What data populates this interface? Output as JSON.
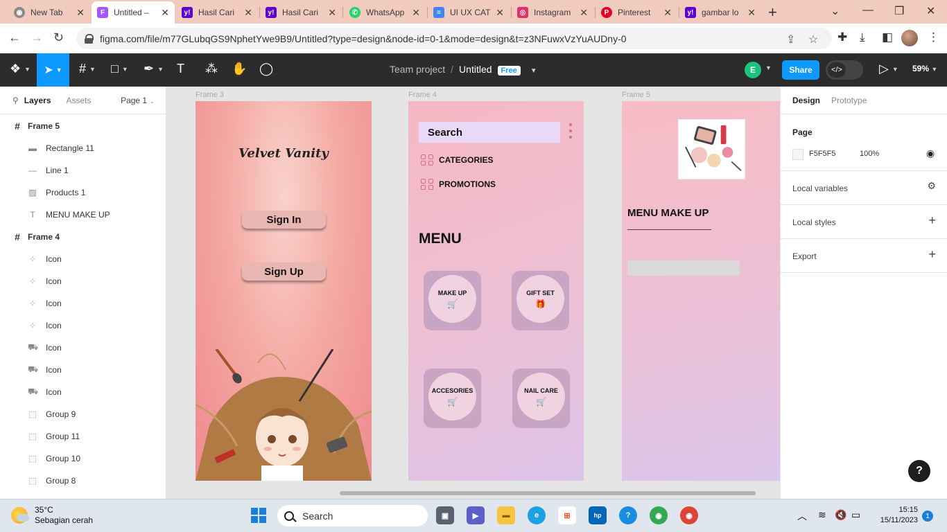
{
  "browser": {
    "tabs": [
      {
        "title": "New Tab",
        "favicon": "chrome-icon",
        "color": "#8a8a8a"
      },
      {
        "title": "Untitled –",
        "favicon": "figma-icon",
        "color": "#a259ff"
      },
      {
        "title": "Hasil Cari",
        "favicon": "yahoo-icon",
        "color": "#6001d2"
      },
      {
        "title": "Hasil Cari",
        "favicon": "yahoo-icon",
        "color": "#6001d2"
      },
      {
        "title": "WhatsApp",
        "favicon": "whatsapp-icon",
        "color": "#25d366"
      },
      {
        "title": "UI UX CAT",
        "favicon": "docs-icon",
        "color": "#4285f4"
      },
      {
        "title": "Instagram",
        "favicon": "instagram-icon",
        "color": "#e1306c"
      },
      {
        "title": "Pinterest",
        "favicon": "pinterest-icon",
        "color": "#e60023"
      },
      {
        "title": "gambar lo",
        "favicon": "yahoo-icon",
        "color": "#6001d2"
      }
    ],
    "url": "figma.com/file/m77GLubqGS9NphetYwe9B9/Untitled?type=design&node-id=0-1&mode=design&t=z3NFuwxVzYuAUDny-0"
  },
  "figma_toolbar": {
    "team": "Team project",
    "file_name": "Untitled",
    "plan_badge": "Free",
    "user_initial": "E",
    "share_label": "Share",
    "zoom": "59%"
  },
  "layers_panel": {
    "tab_layers": "Layers",
    "tab_assets": "Assets",
    "page": "Page 1",
    "items": [
      {
        "label": "Frame 5",
        "type": "frame"
      },
      {
        "label": "Rectangle 11",
        "type": "rect"
      },
      {
        "label": "Line 1",
        "type": "line"
      },
      {
        "label": "Products 1",
        "type": "image"
      },
      {
        "label": "MENU MAKE UP",
        "type": "text"
      },
      {
        "label": "Frame 4",
        "type": "frame"
      },
      {
        "label": "Icon",
        "type": "component"
      },
      {
        "label": "Icon",
        "type": "component"
      },
      {
        "label": "Icon",
        "type": "component"
      },
      {
        "label": "Icon",
        "type": "component"
      },
      {
        "label": "Icon",
        "type": "cart"
      },
      {
        "label": "Icon",
        "type": "cart"
      },
      {
        "label": "Icon",
        "type": "cart"
      },
      {
        "label": "Group 9",
        "type": "group"
      },
      {
        "label": "Group 11",
        "type": "group"
      },
      {
        "label": "Group 10",
        "type": "group"
      },
      {
        "label": "Group 8",
        "type": "group"
      }
    ]
  },
  "canvas": {
    "frame3": {
      "label": "Frame 3",
      "brand": "Velvet Vanity",
      "sign_in": "Sign In",
      "sign_up": "Sign Up"
    },
    "frame4": {
      "label": "Frame 4",
      "search": "Search",
      "categories": "CATEGORIES",
      "promotions": "PROMOTIONS",
      "menu": "MENU",
      "cards": [
        "MAKE UP",
        "GIFT SET",
        "ACCESORIES",
        "NAIL CARE"
      ]
    },
    "frame5": {
      "label": "Frame 5",
      "menu_title": "MENU MAKE UP"
    }
  },
  "design_panel": {
    "tab_design": "Design",
    "tab_prototype": "Prototype",
    "page_section": "Page",
    "page_color": "F5F5F5",
    "page_opacity": "100%",
    "local_variables": "Local variables",
    "local_styles": "Local styles",
    "export": "Export"
  },
  "taskbar": {
    "temperature": "35°C",
    "weather": "Sebagian cerah",
    "search": "Search",
    "time": "15:15",
    "date": "15/11/2023",
    "notifications": "1"
  }
}
